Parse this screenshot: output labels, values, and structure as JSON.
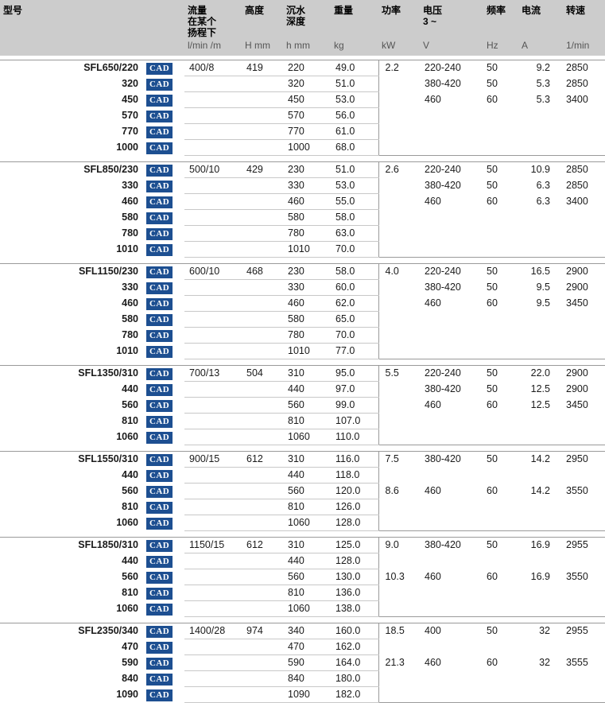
{
  "accent_color": "#1d4f91",
  "header": {
    "columns": [
      {
        "key": "model",
        "lines": [
          "型号"
        ],
        "unit": ""
      },
      {
        "key": "cad",
        "lines": [],
        "unit": ""
      },
      {
        "key": "flow",
        "lines": [
          "流量",
          "在某个",
          "扬程下"
        ],
        "unit": "l/min /m"
      },
      {
        "key": "height",
        "lines": [
          "高度"
        ],
        "unit": "H mm"
      },
      {
        "key": "depth",
        "lines": [
          "沉水",
          "深度"
        ],
        "unit": "h mm"
      },
      {
        "key": "weight",
        "lines": [
          "重量"
        ],
        "unit": "kg"
      },
      {
        "key": "power",
        "lines": [
          "功率"
        ],
        "unit": "kW"
      },
      {
        "key": "volt",
        "lines": [
          "电压",
          "3 ~"
        ],
        "unit": "V"
      },
      {
        "key": "freq",
        "lines": [
          "频率"
        ],
        "unit": "Hz"
      },
      {
        "key": "amp",
        "lines": [
          "电流"
        ],
        "unit": "A"
      },
      {
        "key": "speed",
        "lines": [
          "转速"
        ],
        "unit": "1/min"
      }
    ]
  },
  "cad_label": "CAD",
  "groups": [
    {
      "rows": [
        {
          "model": "SFL650/220",
          "cad": "CAD",
          "flow": "400/8",
          "height": "419",
          "depth": "220",
          "weight": "49.0",
          "power": "2.2",
          "volt": "220-240",
          "freq": "50",
          "amp": "9.2",
          "speed": "2850"
        },
        {
          "model": "320",
          "cad": "CAD",
          "flow": "",
          "height": "",
          "depth": "320",
          "weight": "51.0",
          "power": "",
          "volt": "380-420",
          "freq": "50",
          "amp": "5.3",
          "speed": "2850"
        },
        {
          "model": "450",
          "cad": "CAD",
          "flow": "",
          "height": "",
          "depth": "450",
          "weight": "53.0",
          "power": "",
          "volt": "460",
          "freq": "60",
          "amp": "5.3",
          "speed": "3400"
        },
        {
          "model": "570",
          "cad": "CAD",
          "flow": "",
          "height": "",
          "depth": "570",
          "weight": "56.0",
          "power": "",
          "volt": "",
          "freq": "",
          "amp": "",
          "speed": ""
        },
        {
          "model": "770",
          "cad": "CAD",
          "flow": "",
          "height": "",
          "depth": "770",
          "weight": "61.0",
          "power": "",
          "volt": "",
          "freq": "",
          "amp": "",
          "speed": ""
        },
        {
          "model": "1000",
          "cad": "CAD",
          "flow": "",
          "height": "",
          "depth": "1000",
          "weight": "68.0",
          "power": "",
          "volt": "",
          "freq": "",
          "amp": "",
          "speed": ""
        }
      ]
    },
    {
      "rows": [
        {
          "model": "SFL850/230",
          "cad": "CAD",
          "flow": "500/10",
          "height": "429",
          "depth": "230",
          "weight": "51.0",
          "power": "2.6",
          "volt": "220-240",
          "freq": "50",
          "amp": "10.9",
          "speed": "2850"
        },
        {
          "model": "330",
          "cad": "CAD",
          "flow": "",
          "height": "",
          "depth": "330",
          "weight": "53.0",
          "power": "",
          "volt": "380-420",
          "freq": "50",
          "amp": "6.3",
          "speed": "2850"
        },
        {
          "model": "460",
          "cad": "CAD",
          "flow": "",
          "height": "",
          "depth": "460",
          "weight": "55.0",
          "power": "",
          "volt": "460",
          "freq": "60",
          "amp": "6.3",
          "speed": "3400"
        },
        {
          "model": "580",
          "cad": "CAD",
          "flow": "",
          "height": "",
          "depth": "580",
          "weight": "58.0",
          "power": "",
          "volt": "",
          "freq": "",
          "amp": "",
          "speed": ""
        },
        {
          "model": "780",
          "cad": "CAD",
          "flow": "",
          "height": "",
          "depth": "780",
          "weight": "63.0",
          "power": "",
          "volt": "",
          "freq": "",
          "amp": "",
          "speed": ""
        },
        {
          "model": "1010",
          "cad": "CAD",
          "flow": "",
          "height": "",
          "depth": "1010",
          "weight": "70.0",
          "power": "",
          "volt": "",
          "freq": "",
          "amp": "",
          "speed": ""
        }
      ]
    },
    {
      "rows": [
        {
          "model": "SFL1150/230",
          "cad": "CAD",
          "flow": "600/10",
          "height": "468",
          "depth": "230",
          "weight": "58.0",
          "power": "4.0",
          "volt": "220-240",
          "freq": "50",
          "amp": "16.5",
          "speed": "2900"
        },
        {
          "model": "330",
          "cad": "CAD",
          "flow": "",
          "height": "",
          "depth": "330",
          "weight": "60.0",
          "power": "",
          "volt": "380-420",
          "freq": "50",
          "amp": "9.5",
          "speed": "2900"
        },
        {
          "model": "460",
          "cad": "CAD",
          "flow": "",
          "height": "",
          "depth": "460",
          "weight": "62.0",
          "power": "",
          "volt": "460",
          "freq": "60",
          "amp": "9.5",
          "speed": "3450"
        },
        {
          "model": "580",
          "cad": "CAD",
          "flow": "",
          "height": "",
          "depth": "580",
          "weight": "65.0",
          "power": "",
          "volt": "",
          "freq": "",
          "amp": "",
          "speed": ""
        },
        {
          "model": "780",
          "cad": "CAD",
          "flow": "",
          "height": "",
          "depth": "780",
          "weight": "70.0",
          "power": "",
          "volt": "",
          "freq": "",
          "amp": "",
          "speed": ""
        },
        {
          "model": "1010",
          "cad": "CAD",
          "flow": "",
          "height": "",
          "depth": "1010",
          "weight": "77.0",
          "power": "",
          "volt": "",
          "freq": "",
          "amp": "",
          "speed": ""
        }
      ]
    },
    {
      "rows": [
        {
          "model": "SFL1350/310",
          "cad": "CAD",
          "flow": "700/13",
          "height": "504",
          "depth": "310",
          "weight": "95.0",
          "power": "5.5",
          "volt": "220-240",
          "freq": "50",
          "amp": "22.0",
          "speed": "2900"
        },
        {
          "model": "440",
          "cad": "CAD",
          "flow": "",
          "height": "",
          "depth": "440",
          "weight": "97.0",
          "power": "",
          "volt": "380-420",
          "freq": "50",
          "amp": "12.5",
          "speed": "2900"
        },
        {
          "model": "560",
          "cad": "CAD",
          "flow": "",
          "height": "",
          "depth": "560",
          "weight": "99.0",
          "power": "",
          "volt": "460",
          "freq": "60",
          "amp": "12.5",
          "speed": "3450"
        },
        {
          "model": "810",
          "cad": "CAD",
          "flow": "",
          "height": "",
          "depth": "810",
          "weight": "107.0",
          "power": "",
          "volt": "",
          "freq": "",
          "amp": "",
          "speed": ""
        },
        {
          "model": "1060",
          "cad": "CAD",
          "flow": "",
          "height": "",
          "depth": "1060",
          "weight": "110.0",
          "power": "",
          "volt": "",
          "freq": "",
          "amp": "",
          "speed": ""
        }
      ]
    },
    {
      "rows": [
        {
          "model": "SFL1550/310",
          "cad": "CAD",
          "flow": "900/15",
          "height": "612",
          "depth": "310",
          "weight": "116.0",
          "power": "7.5",
          "volt": "380-420",
          "freq": "50",
          "amp": "14.2",
          "speed": "2950"
        },
        {
          "model": "440",
          "cad": "CAD",
          "flow": "",
          "height": "",
          "depth": "440",
          "weight": "118.0",
          "power": "",
          "volt": "",
          "freq": "",
          "amp": "",
          "speed": ""
        },
        {
          "model": "560",
          "cad": "CAD",
          "flow": "",
          "height": "",
          "depth": "560",
          "weight": "120.0",
          "power": "8.6",
          "volt": "460",
          "freq": "60",
          "amp": "14.2",
          "speed": "3550"
        },
        {
          "model": "810",
          "cad": "CAD",
          "flow": "",
          "height": "",
          "depth": "810",
          "weight": "126.0",
          "power": "",
          "volt": "",
          "freq": "",
          "amp": "",
          "speed": ""
        },
        {
          "model": "1060",
          "cad": "CAD",
          "flow": "",
          "height": "",
          "depth": "1060",
          "weight": "128.0",
          "power": "",
          "volt": "",
          "freq": "",
          "amp": "",
          "speed": ""
        }
      ]
    },
    {
      "rows": [
        {
          "model": "SFL1850/310",
          "cad": "CAD",
          "flow": "1150/15",
          "height": "612",
          "depth": "310",
          "weight": "125.0",
          "power": "9.0",
          "volt": "380-420",
          "freq": "50",
          "amp": "16.9",
          "speed": "2955"
        },
        {
          "model": "440",
          "cad": "CAD",
          "flow": "",
          "height": "",
          "depth": "440",
          "weight": "128.0",
          "power": "",
          "volt": "",
          "freq": "",
          "amp": "",
          "speed": ""
        },
        {
          "model": "560",
          "cad": "CAD",
          "flow": "",
          "height": "",
          "depth": "560",
          "weight": "130.0",
          "power": "10.3",
          "volt": "460",
          "freq": "60",
          "amp": "16.9",
          "speed": "3550"
        },
        {
          "model": "810",
          "cad": "CAD",
          "flow": "",
          "height": "",
          "depth": "810",
          "weight": "136.0",
          "power": "",
          "volt": "",
          "freq": "",
          "amp": "",
          "speed": ""
        },
        {
          "model": "1060",
          "cad": "CAD",
          "flow": "",
          "height": "",
          "depth": "1060",
          "weight": "138.0",
          "power": "",
          "volt": "",
          "freq": "",
          "amp": "",
          "speed": ""
        }
      ]
    },
    {
      "rows": [
        {
          "model": "SFL2350/340",
          "cad": "CAD",
          "flow": "1400/28",
          "height": "974",
          "depth": "340",
          "weight": "160.0",
          "power": "18.5",
          "volt": "400",
          "freq": "50",
          "amp": "32",
          "speed": "2955"
        },
        {
          "model": "470",
          "cad": "CAD",
          "flow": "",
          "height": "",
          "depth": "470",
          "weight": "162.0",
          "power": "",
          "volt": "",
          "freq": "",
          "amp": "",
          "speed": ""
        },
        {
          "model": "590",
          "cad": "CAD",
          "flow": "",
          "height": "",
          "depth": "590",
          "weight": "164.0",
          "power": "21.3",
          "volt": "460",
          "freq": "60",
          "amp": "32",
          "speed": "3555"
        },
        {
          "model": "840",
          "cad": "CAD",
          "flow": "",
          "height": "",
          "depth": "840",
          "weight": "180.0",
          "power": "",
          "volt": "",
          "freq": "",
          "amp": "",
          "speed": ""
        },
        {
          "model": "1090",
          "cad": "CAD",
          "flow": "",
          "height": "",
          "depth": "1090",
          "weight": "182.0",
          "power": "",
          "volt": "",
          "freq": "",
          "amp": "",
          "speed": ""
        }
      ]
    }
  ]
}
